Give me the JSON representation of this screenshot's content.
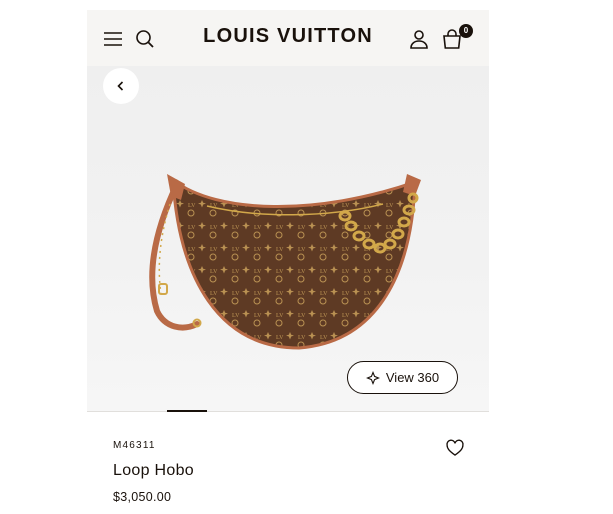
{
  "header": {
    "brand": "LOUIS VUITTON",
    "cart_count": "0",
    "icons": [
      "menu-icon",
      "search-icon",
      "account-icon",
      "shopping-bag-icon"
    ]
  },
  "gallery": {
    "view360_label": "View 360",
    "icons": [
      "chevron-left-icon",
      "rotate-360-icon"
    ]
  },
  "product": {
    "sku": "M46311",
    "name": "Loop Hobo",
    "price": "$3,050.00"
  },
  "colors": {
    "text": "#19110b",
    "header_bg": "#f6f5f3",
    "monogram_brown": "#5e3a24",
    "leather_trim": "#b96a46",
    "gold": "#d2a84a"
  }
}
